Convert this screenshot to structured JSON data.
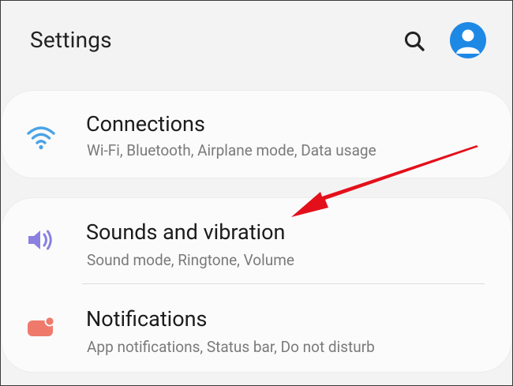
{
  "header": {
    "title": "Settings",
    "search_icon": "search-icon",
    "avatar_icon": "account-icon"
  },
  "colors": {
    "accent_blue": "#1e88e5",
    "wifi_icon": "#4aa3e6",
    "sound_icon": "#8a80e0",
    "notification_icon": "#ef7a6b",
    "annotation_arrow": "#e3101b"
  },
  "items": [
    {
      "title": "Connections",
      "subtitle": "Wi-Fi, Bluetooth, Airplane mode, Data usage",
      "icon": "wifi-icon"
    },
    {
      "title": "Sounds and vibration",
      "subtitle": "Sound mode, Ringtone, Volume",
      "icon": "volume-icon"
    },
    {
      "title": "Notifications",
      "subtitle": "App notifications, Status bar, Do not disturb",
      "icon": "notification-icon"
    }
  ]
}
